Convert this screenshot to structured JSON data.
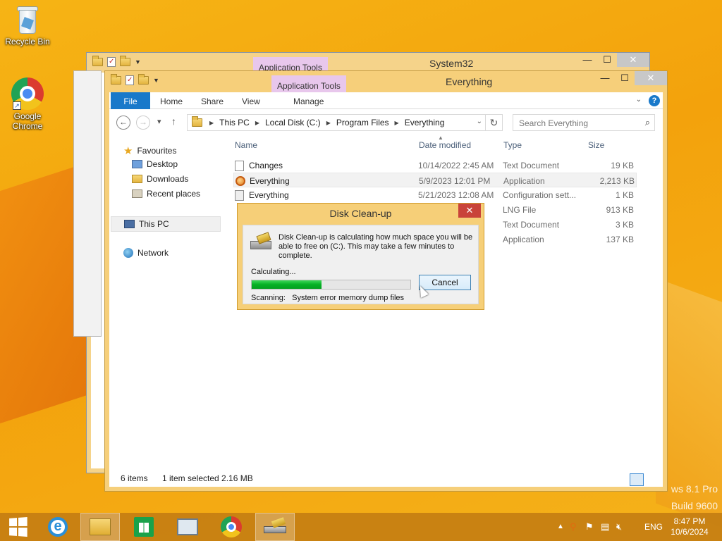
{
  "desktop": {
    "icons": [
      {
        "label": "Recycle Bin"
      },
      {
        "label": "Google Chrome"
      }
    ],
    "watermark": {
      "line1": "ws 8.1 Pro",
      "line2": "Build 9600"
    }
  },
  "back_window": {
    "title": "System32",
    "context_tab": "Application Tools"
  },
  "window": {
    "title": "Everything",
    "context_tab": "Application Tools",
    "ribbon_tabs": [
      "File",
      "Home",
      "Share",
      "View",
      "Manage"
    ],
    "breadcrumbs": [
      "This PC",
      "Local Disk (C:)",
      "Program Files",
      "Everything"
    ],
    "search_placeholder": "Search Everything",
    "nav_pane": {
      "favourites": "Favourites",
      "items": [
        "Desktop",
        "Downloads",
        "Recent places"
      ],
      "this_pc": "This PC",
      "network": "Network"
    },
    "columns": [
      "Name",
      "Date modified",
      "Type",
      "Size"
    ],
    "files": [
      {
        "name": "Changes",
        "date": "10/14/2022 2:45 AM",
        "type": "Text Document",
        "size": "19 KB",
        "icon": "text-file-icon",
        "selected": false
      },
      {
        "name": "Everything",
        "date": "5/9/2023 12:01 PM",
        "type": "Application",
        "size": "2,213 KB",
        "icon": "everything-app-icon",
        "selected": true
      },
      {
        "name": "Everything",
        "date": "5/21/2023 12:08 AM",
        "type": "Configuration sett...",
        "size": "1 KB",
        "icon": "config-file-icon",
        "selected": false
      },
      {
        "name": "",
        "date": "",
        "type": "LNG File",
        "size": "913 KB",
        "icon": "",
        "selected": false
      },
      {
        "name": "",
        "date": "",
        "type": "Text Document",
        "size": "3 KB",
        "icon": "",
        "selected": false
      },
      {
        "name": "",
        "date": "",
        "type": "Application",
        "size": "137 KB",
        "icon": "",
        "selected": false
      }
    ],
    "status": {
      "items": "6 items",
      "selected": "1 item selected  2.16 MB"
    }
  },
  "dialog": {
    "title": "Disk Clean-up",
    "close": "✕",
    "message": "Disk Clean-up is calculating how much space you will be able to free on  (C:). This may take a few minutes to complete.",
    "calculating": "Calculating...",
    "progress": 0.44,
    "scanning_label": "Scanning:",
    "scanning_item": "System error memory dump files",
    "cancel": "Cancel"
  },
  "taskbar": {
    "language": "ENG",
    "time": "8:47 PM",
    "date": "10/6/2024"
  },
  "colors": {
    "accent": "#1979ca",
    "progress_green": "#06b025",
    "close_red": "#c9433a",
    "context_tab": "#e8c7ec"
  }
}
